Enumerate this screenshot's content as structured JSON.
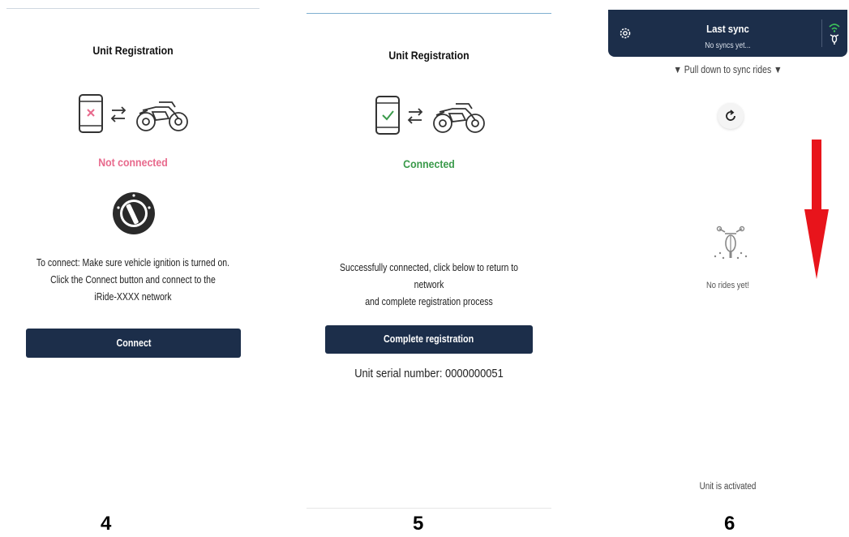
{
  "panels": [
    {
      "title": "Unit Registration",
      "status": "Not connected",
      "status_color": "#e8698c",
      "instructions": [
        "To connect: Make sure vehicle ignition is turned on.",
        "Click the Connect button and connect to the",
        "iRide-XXXX network"
      ],
      "button": "Connect",
      "caption": "4",
      "icons": [
        "phone-error-icon",
        "swap-arrows-icon",
        "motorcycle-icon",
        "ignition-key-icon"
      ]
    },
    {
      "title": "Unit Registration",
      "status": "Connected",
      "status_color": "#3a9a4a",
      "message": [
        "Successfully connected, click below to return to network",
        "and complete registration process"
      ],
      "button": "Complete registration",
      "serial": "Unit serial number: 0000000051",
      "caption": "5",
      "icons": [
        "phone-check-icon",
        "swap-arrows-icon",
        "motorcycle-icon"
      ]
    },
    {
      "header_title": "Last sync",
      "header_subtitle": "No syncs yet...",
      "pull_hint": "▼ Pull down to sync rides ▼",
      "empty_text": "No rides yet!",
      "footer": "Unit is activated",
      "caption": "6",
      "arrow_color": "#e8141b",
      "icons": [
        "settings-gear-icon",
        "wifi-motorcycle-icon",
        "refresh-icon",
        "motorcycle-front-icon",
        "red-down-arrow-icon"
      ]
    }
  ],
  "colors": {
    "navy": "#1c2e4a",
    "pink": "#e8698c",
    "green": "#3a9a4a",
    "red": "#e8141b"
  }
}
